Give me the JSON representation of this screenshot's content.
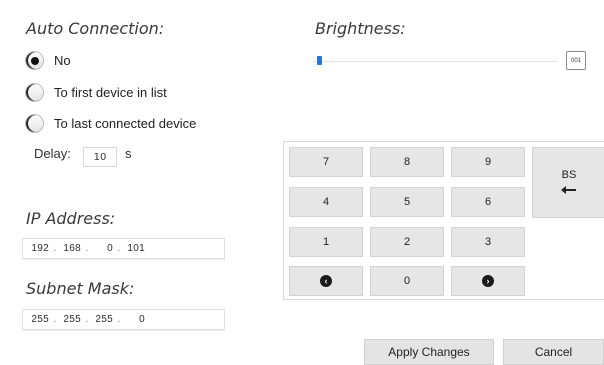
{
  "auto_connection": {
    "title": "Auto Connection:",
    "options": [
      {
        "label": "No",
        "selected": true
      },
      {
        "label": "To first device in list",
        "selected": false
      },
      {
        "label": "To last connected device",
        "selected": false
      }
    ],
    "delay_label": "Delay:",
    "delay_value": "10",
    "delay_unit": "s"
  },
  "ip_address": {
    "title": "IP Address:",
    "octets": [
      "192",
      "168",
      "0",
      "101"
    ]
  },
  "subnet_mask": {
    "title": "Subnet Mask:",
    "octets": [
      "255",
      "255",
      "255",
      "0"
    ]
  },
  "brightness": {
    "title": "Brightness:",
    "value_text": "001",
    "level_fraction": 0.01
  },
  "keypad": {
    "keys": [
      "7",
      "8",
      "9",
      "4",
      "5",
      "6",
      "1",
      "2",
      "3",
      "0"
    ],
    "backspace_label": "BS",
    "backspace_icon": "left-arrow-icon",
    "left_icon": "arrow-left-circle-icon",
    "right_icon": "arrow-right-circle-icon"
  },
  "footer": {
    "apply_label": "Apply Changes",
    "cancel_label": "Cancel"
  },
  "colors": {
    "slider_thumb": "#1c7ad8",
    "key_background": "#e6e6e6"
  }
}
